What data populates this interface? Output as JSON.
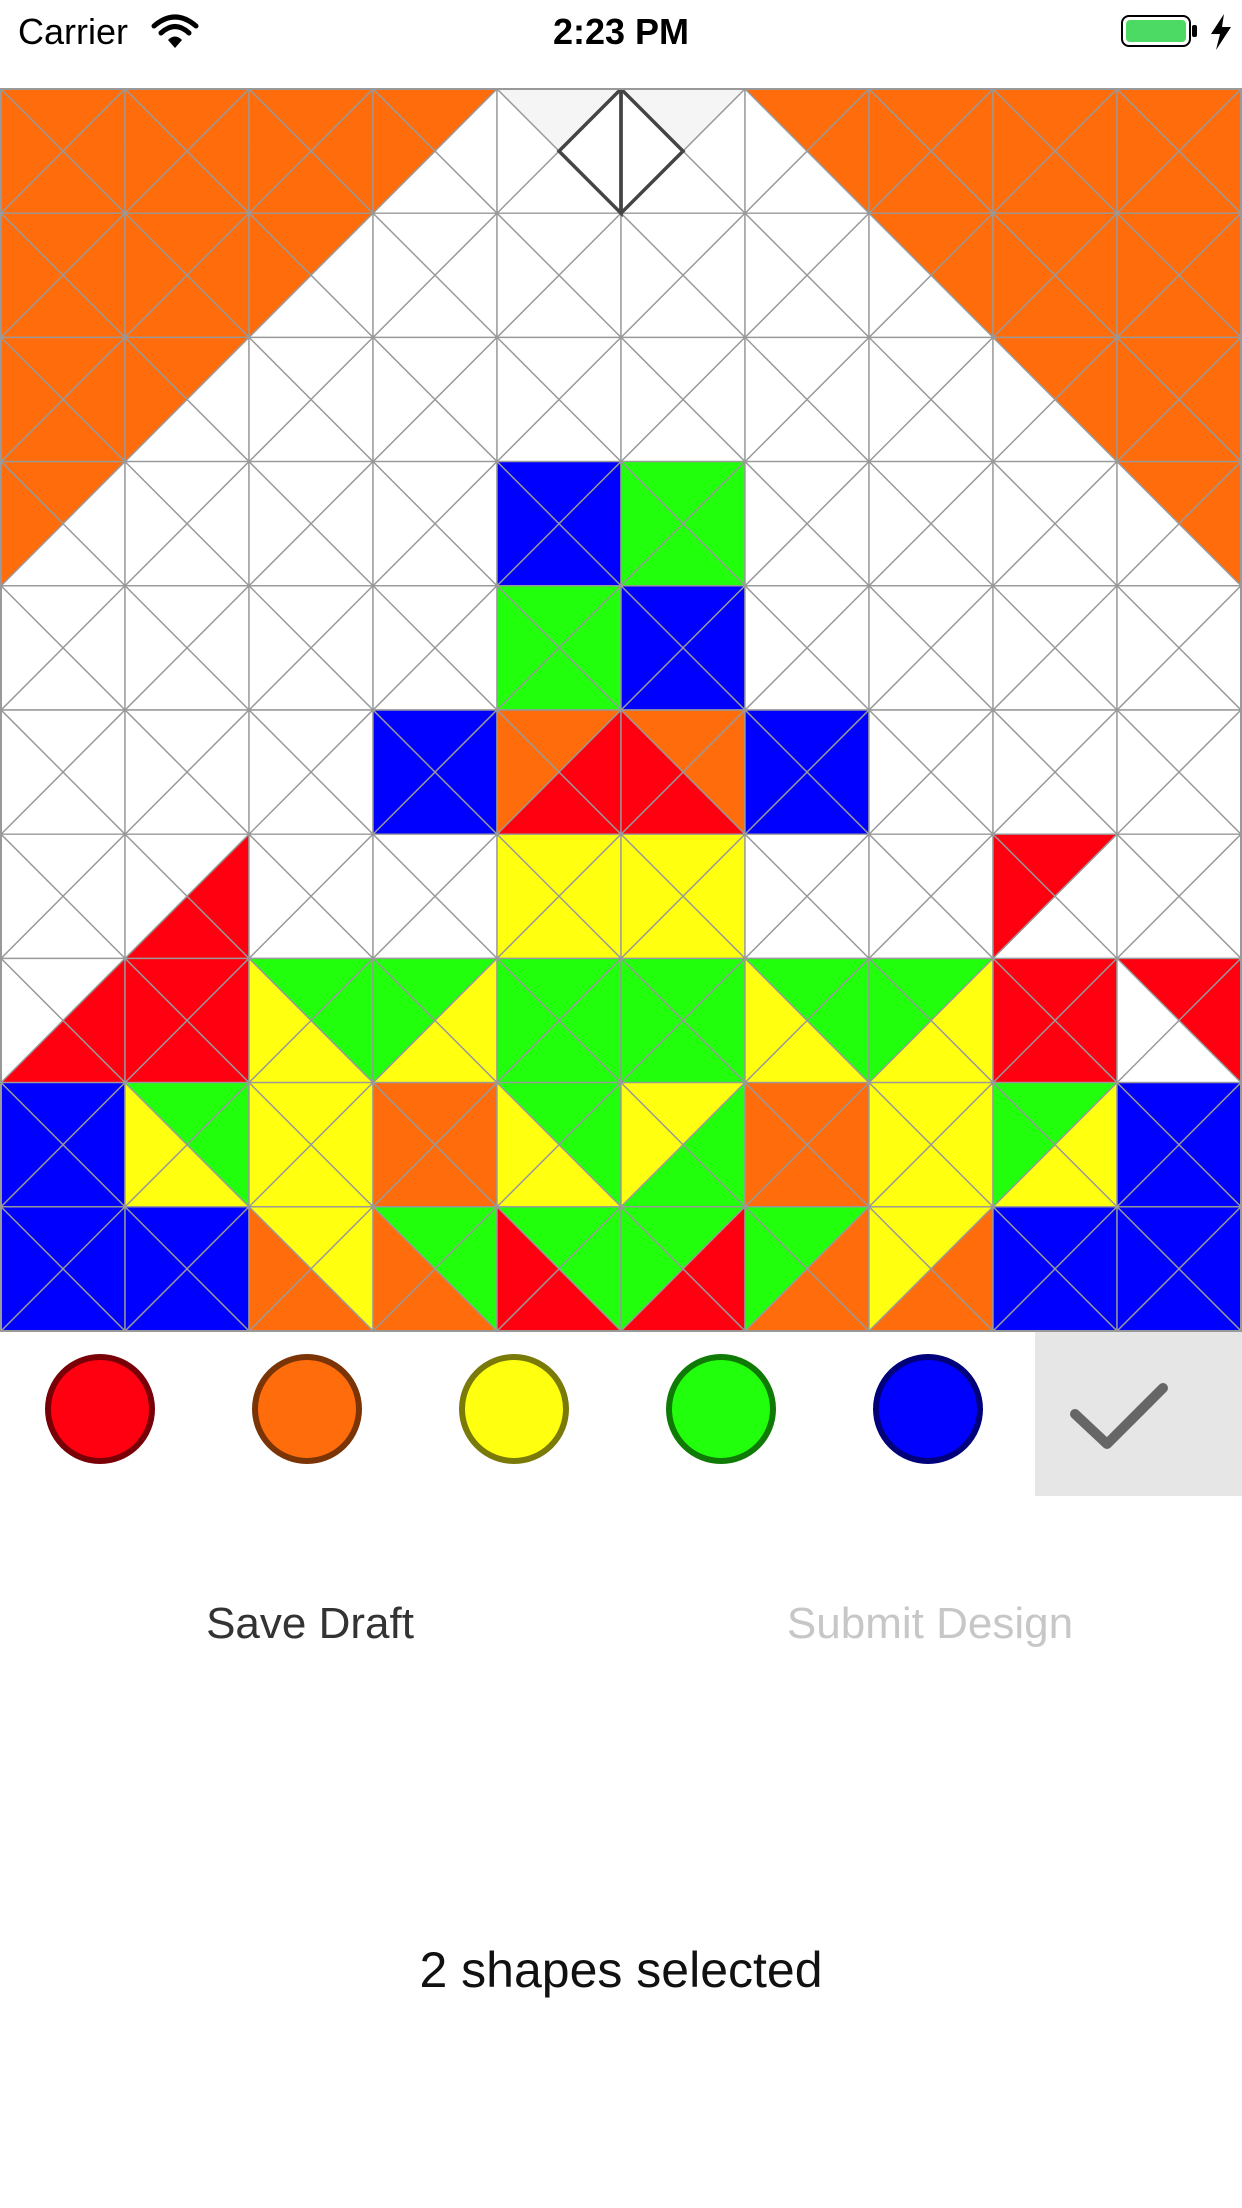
{
  "status_bar": {
    "carrier": "Carrier",
    "time": "2:23 PM",
    "battery_level": 1.0,
    "battery_color": "#4cd964",
    "icons": [
      "wifi-icon",
      "battery-icon",
      "charging-icon"
    ]
  },
  "canvas": {
    "rows": 10,
    "cols": 10,
    "empty_color": "#ffffff",
    "selected_color": "#f5f5f5",
    "grid_color": "#999999",
    "color_codes": {
      "W": "#ffffff",
      "O": "#ff6c0c",
      "R": "#ff0010",
      "Y": "#ffff10",
      "G": "#22ff0c",
      "B": "#0000ff",
      "S": "#f5f5f5"
    },
    "tile_order": "top right bottom left",
    "tiles": [
      [
        "OOOO",
        "OOOO",
        "OOOO",
        "OWWO",
        "SWWW",
        "SWWW",
        "OOWW",
        "OOOO",
        "OOOO",
        "OOOO"
      ],
      [
        "OOOO",
        "OOOO",
        "OWWO",
        "WWWW",
        "WWWW",
        "WWWW",
        "WWWW",
        "OOWW",
        "OOOO",
        "OOOO"
      ],
      [
        "OOOO",
        "OWWO",
        "WWWW",
        "WWWW",
        "WWWW",
        "WWWW",
        "WWWW",
        "WWWW",
        "OOWW",
        "OOOO"
      ],
      [
        "OWWO",
        "WWWW",
        "WWWW",
        "WWWW",
        "BBBB",
        "GGGG",
        "WWWW",
        "WWWW",
        "WWWW",
        "OOWW"
      ],
      [
        "WWWW",
        "WWWW",
        "WWWW",
        "WWWW",
        "GGGG",
        "BBBB",
        "WWWW",
        "WWWW",
        "WWWW",
        "WWWW"
      ],
      [
        "WWWW",
        "WWWW",
        "WWWW",
        "BBBB",
        "ORRO",
        "OORR",
        "BBBB",
        "WWWW",
        "WWWW",
        "WWWW"
      ],
      [
        "WWWW",
        "WRRW",
        "WWWW",
        "WWWW",
        "YYYY",
        "YYYY",
        "WWWW",
        "WWWW",
        "RWWR",
        "WWWW"
      ],
      [
        "WRRW",
        "RRRR",
        "GGYY",
        "GYYG",
        "GGGG",
        "GGGG",
        "GGYY",
        "GYYG",
        "RRRR",
        "RRWW"
      ],
      [
        "BBBB",
        "GGYY",
        "YYYY",
        "OOOO",
        "GGYY",
        "YGGY",
        "OOOO",
        "YYYY",
        "GYYG",
        "BBBB"
      ],
      [
        "BBBB",
        "BBBB",
        "YYOO",
        "GGOO",
        "GGRR",
        "GRRG",
        "GOOG",
        "YOOY",
        "BBBB",
        "BBBB"
      ]
    ],
    "selected_shapes": [
      [
        0,
        4,
        "right"
      ],
      [
        0,
        5,
        "left"
      ]
    ]
  },
  "palette": {
    "colors": [
      {
        "name": "red",
        "fill": "#ff0010",
        "border": "#7a0008"
      },
      {
        "name": "orange",
        "fill": "#ff6c0c",
        "border": "#7a3406"
      },
      {
        "name": "yellow",
        "fill": "#ffff10",
        "border": "#7a7a08"
      },
      {
        "name": "green",
        "fill": "#22ff0c",
        "border": "#107a06"
      },
      {
        "name": "blue",
        "fill": "#0000ff",
        "border": "#00007a"
      }
    ],
    "confirm_icon": "checkmark-icon"
  },
  "actions": {
    "save_draft": "Save Draft",
    "submit_design": "Submit Design",
    "submit_enabled": false
  },
  "selection_status": "2 shapes selected"
}
